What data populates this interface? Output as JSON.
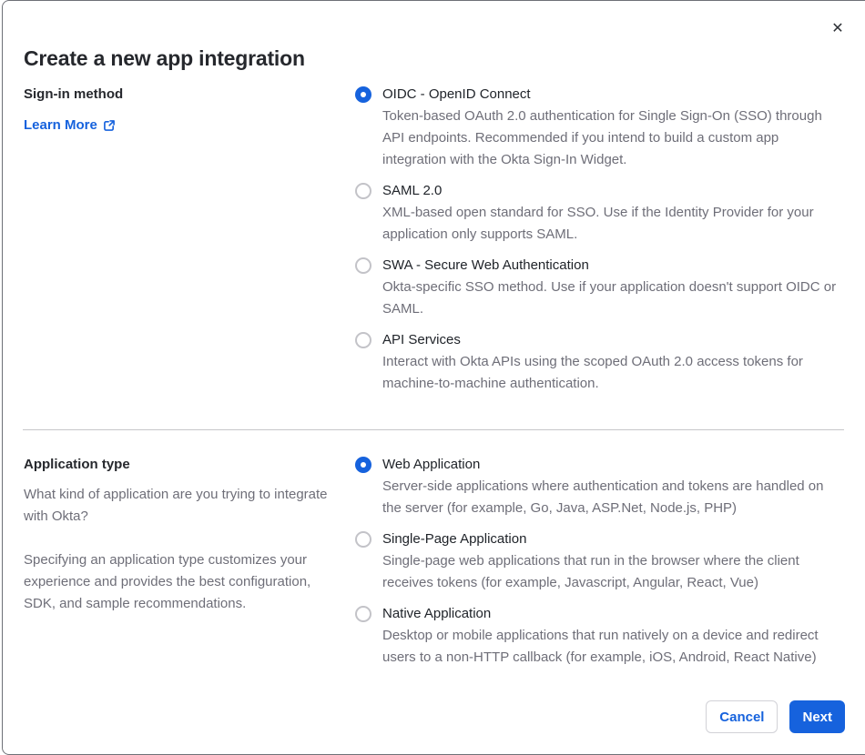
{
  "dialog": {
    "title": "Create a new app integration",
    "close_glyph": "✕"
  },
  "colors": {
    "accent_blue": "#1662dd",
    "text_dark": "#26282d",
    "text_gray": "#6e6e78",
    "radio_border": "#c3c3c8",
    "divider": "#c6c6c9",
    "frame_border": "#6e7077"
  },
  "signin": {
    "label": "Sign-in method",
    "learn_more_label": "Learn More",
    "options": [
      {
        "label": "OIDC - OpenID Connect",
        "description": "Token-based OAuth 2.0 authentication for Single Sign-On (SSO) through API endpoints. Recommended if you intend to build a custom app integration with the Okta Sign-In Widget.",
        "selected": true
      },
      {
        "label": "SAML 2.0",
        "description": "XML-based open standard for SSO. Use if the Identity Provider for your application only supports SAML.",
        "selected": false
      },
      {
        "label": "SWA - Secure Web Authentication",
        "description": "Okta-specific SSO method. Use if your application doesn't support OIDC or SAML.",
        "selected": false
      },
      {
        "label": "API Services",
        "description": "Interact with Okta APIs using the scoped OAuth 2.0 access tokens for machine-to-machine authentication.",
        "selected": false
      }
    ]
  },
  "apptype": {
    "label": "Application type",
    "paragraph1": "What kind of application are you trying to integrate with Okta?",
    "paragraph2": "Specifying an application type customizes your experience and provides the best configuration, SDK, and sample recommendations.",
    "options": [
      {
        "label": "Web Application",
        "description": "Server-side applications where authentication and tokens are handled on the server (for example, Go, Java, ASP.Net, Node.js, PHP)",
        "selected": true
      },
      {
        "label": "Single-Page Application",
        "description": "Single-page web applications that run in the browser where the client receives tokens (for example, Javascript, Angular, React, Vue)",
        "selected": false
      },
      {
        "label": "Native Application",
        "description": "Desktop or mobile applications that run natively on a device and redirect users to a non-HTTP callback (for example, iOS, Android, React Native)",
        "selected": false
      }
    ]
  },
  "footer": {
    "cancel_label": "Cancel",
    "next_label": "Next"
  }
}
